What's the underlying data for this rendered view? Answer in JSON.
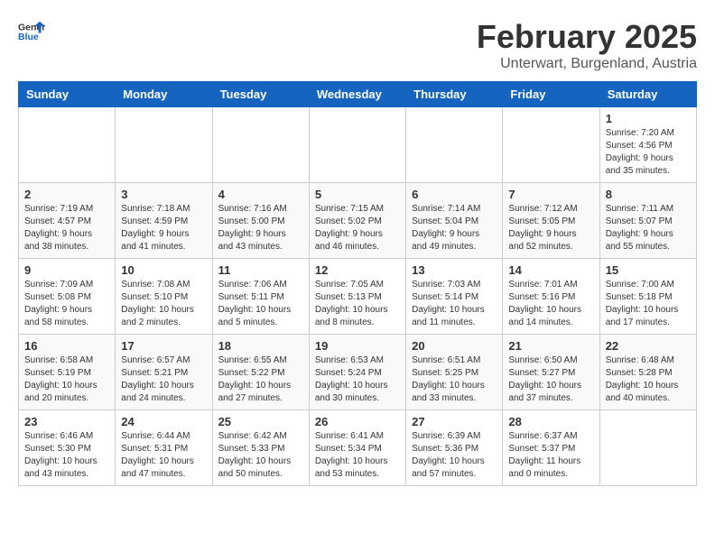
{
  "logo": {
    "general": "General",
    "blue": "Blue"
  },
  "title": "February 2025",
  "subtitle": "Unterwart, Burgenland, Austria",
  "days_of_week": [
    "Sunday",
    "Monday",
    "Tuesday",
    "Wednesday",
    "Thursday",
    "Friday",
    "Saturday"
  ],
  "weeks": [
    [
      {
        "day": "",
        "info": ""
      },
      {
        "day": "",
        "info": ""
      },
      {
        "day": "",
        "info": ""
      },
      {
        "day": "",
        "info": ""
      },
      {
        "day": "",
        "info": ""
      },
      {
        "day": "",
        "info": ""
      },
      {
        "day": "1",
        "info": "Sunrise: 7:20 AM\nSunset: 4:56 PM\nDaylight: 9 hours and 35 minutes."
      }
    ],
    [
      {
        "day": "2",
        "info": "Sunrise: 7:19 AM\nSunset: 4:57 PM\nDaylight: 9 hours and 38 minutes."
      },
      {
        "day": "3",
        "info": "Sunrise: 7:18 AM\nSunset: 4:59 PM\nDaylight: 9 hours and 41 minutes."
      },
      {
        "day": "4",
        "info": "Sunrise: 7:16 AM\nSunset: 5:00 PM\nDaylight: 9 hours and 43 minutes."
      },
      {
        "day": "5",
        "info": "Sunrise: 7:15 AM\nSunset: 5:02 PM\nDaylight: 9 hours and 46 minutes."
      },
      {
        "day": "6",
        "info": "Sunrise: 7:14 AM\nSunset: 5:04 PM\nDaylight: 9 hours and 49 minutes."
      },
      {
        "day": "7",
        "info": "Sunrise: 7:12 AM\nSunset: 5:05 PM\nDaylight: 9 hours and 52 minutes."
      },
      {
        "day": "8",
        "info": "Sunrise: 7:11 AM\nSunset: 5:07 PM\nDaylight: 9 hours and 55 minutes."
      }
    ],
    [
      {
        "day": "9",
        "info": "Sunrise: 7:09 AM\nSunset: 5:08 PM\nDaylight: 9 hours and 58 minutes."
      },
      {
        "day": "10",
        "info": "Sunrise: 7:08 AM\nSunset: 5:10 PM\nDaylight: 10 hours and 2 minutes."
      },
      {
        "day": "11",
        "info": "Sunrise: 7:06 AM\nSunset: 5:11 PM\nDaylight: 10 hours and 5 minutes."
      },
      {
        "day": "12",
        "info": "Sunrise: 7:05 AM\nSunset: 5:13 PM\nDaylight: 10 hours and 8 minutes."
      },
      {
        "day": "13",
        "info": "Sunrise: 7:03 AM\nSunset: 5:14 PM\nDaylight: 10 hours and 11 minutes."
      },
      {
        "day": "14",
        "info": "Sunrise: 7:01 AM\nSunset: 5:16 PM\nDaylight: 10 hours and 14 minutes."
      },
      {
        "day": "15",
        "info": "Sunrise: 7:00 AM\nSunset: 5:18 PM\nDaylight: 10 hours and 17 minutes."
      }
    ],
    [
      {
        "day": "16",
        "info": "Sunrise: 6:58 AM\nSunset: 5:19 PM\nDaylight: 10 hours and 20 minutes."
      },
      {
        "day": "17",
        "info": "Sunrise: 6:57 AM\nSunset: 5:21 PM\nDaylight: 10 hours and 24 minutes."
      },
      {
        "day": "18",
        "info": "Sunrise: 6:55 AM\nSunset: 5:22 PM\nDaylight: 10 hours and 27 minutes."
      },
      {
        "day": "19",
        "info": "Sunrise: 6:53 AM\nSunset: 5:24 PM\nDaylight: 10 hours and 30 minutes."
      },
      {
        "day": "20",
        "info": "Sunrise: 6:51 AM\nSunset: 5:25 PM\nDaylight: 10 hours and 33 minutes."
      },
      {
        "day": "21",
        "info": "Sunrise: 6:50 AM\nSunset: 5:27 PM\nDaylight: 10 hours and 37 minutes."
      },
      {
        "day": "22",
        "info": "Sunrise: 6:48 AM\nSunset: 5:28 PM\nDaylight: 10 hours and 40 minutes."
      }
    ],
    [
      {
        "day": "23",
        "info": "Sunrise: 6:46 AM\nSunset: 5:30 PM\nDaylight: 10 hours and 43 minutes."
      },
      {
        "day": "24",
        "info": "Sunrise: 6:44 AM\nSunset: 5:31 PM\nDaylight: 10 hours and 47 minutes."
      },
      {
        "day": "25",
        "info": "Sunrise: 6:42 AM\nSunset: 5:33 PM\nDaylight: 10 hours and 50 minutes."
      },
      {
        "day": "26",
        "info": "Sunrise: 6:41 AM\nSunset: 5:34 PM\nDaylight: 10 hours and 53 minutes."
      },
      {
        "day": "27",
        "info": "Sunrise: 6:39 AM\nSunset: 5:36 PM\nDaylight: 10 hours and 57 minutes."
      },
      {
        "day": "28",
        "info": "Sunrise: 6:37 AM\nSunset: 5:37 PM\nDaylight: 11 hours and 0 minutes."
      },
      {
        "day": "",
        "info": ""
      }
    ]
  ]
}
